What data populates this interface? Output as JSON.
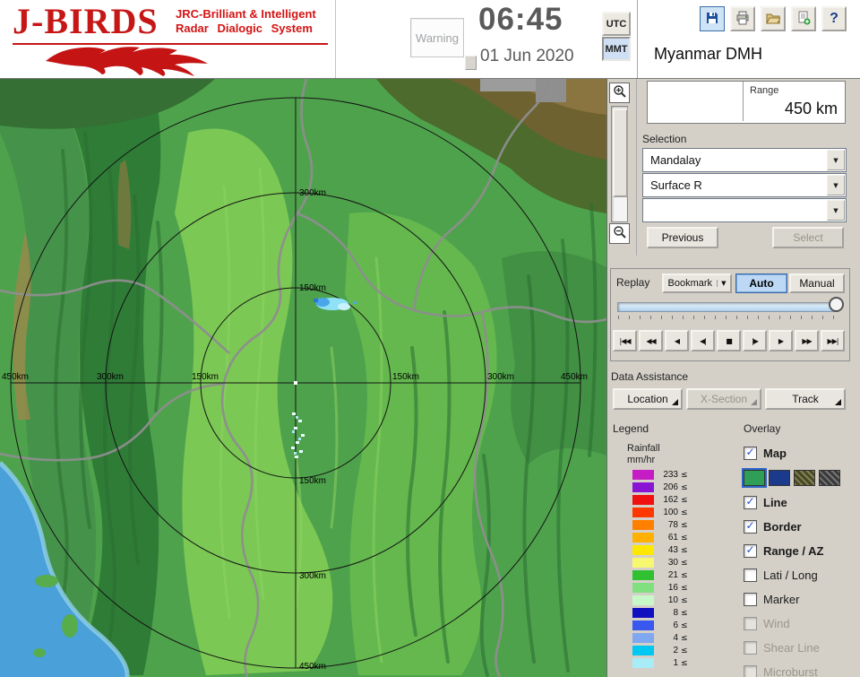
{
  "header": {
    "logo": {
      "title": "J-BIRDS",
      "subtitle1": "JRC-Brilliant & Intelligent",
      "subtitle2": "Radar Dialogic System"
    },
    "warning": "Warning",
    "time": "06:45",
    "date": "01 Jun 2020",
    "tz": {
      "utc": "UTC",
      "mmt": "MMT",
      "selected": "MMT"
    },
    "station": "Myanmar DMH",
    "help_glyph": "?"
  },
  "range": {
    "label": "Range",
    "value": "450 km"
  },
  "selection": {
    "title": "Selection",
    "dropdowns": [
      {
        "value": "Mandalay"
      },
      {
        "value": "Surface R"
      },
      {
        "value": ""
      }
    ],
    "previous": "Previous",
    "select": "Select"
  },
  "replay": {
    "title": "Replay",
    "bookmark": "Bookmark",
    "auto": "Auto",
    "manual": "Manual",
    "playback": [
      {
        "name": "jump-start",
        "glyph": "|◀◀"
      },
      {
        "name": "rewind",
        "glyph": "◀◀"
      },
      {
        "name": "step-back",
        "glyph": "◀"
      },
      {
        "name": "pause-back",
        "glyph": "◀|"
      },
      {
        "name": "stop",
        "glyph": "■"
      },
      {
        "name": "pause-forward",
        "glyph": "|▶"
      },
      {
        "name": "play",
        "glyph": "▶"
      },
      {
        "name": "fast-forward",
        "glyph": "▶▶"
      },
      {
        "name": "jump-end",
        "glyph": "▶▶|"
      }
    ]
  },
  "assist": {
    "title": "Data Assistance",
    "location": "Location",
    "xsection": "X-Section",
    "track": "Track"
  },
  "legend": {
    "title": "Legend",
    "unit1": "Rainfall",
    "unit2": "mm/hr",
    "suffix": "≤",
    "rows": [
      {
        "value": "233",
        "color": "#C61CC6"
      },
      {
        "value": "206",
        "color": "#8A14D4"
      },
      {
        "value": "162",
        "color": "#F01010"
      },
      {
        "value": "100",
        "color": "#FF3800"
      },
      {
        "value": "78",
        "color": "#FF8000"
      },
      {
        "value": "61",
        "color": "#FFB000"
      },
      {
        "value": "43",
        "color": "#FFE800"
      },
      {
        "value": "30",
        "color": "#F8F870"
      },
      {
        "value": "21",
        "color": "#30C030"
      },
      {
        "value": "16",
        "color": "#80E080"
      },
      {
        "value": "10",
        "color": "#C8F8C8"
      },
      {
        "value": "8",
        "color": "#1010C0"
      },
      {
        "value": "6",
        "color": "#3858F0"
      },
      {
        "value": "4",
        "color": "#80A8F0"
      },
      {
        "value": "2",
        "color": "#00C8F0"
      },
      {
        "value": "1",
        "color": "#A8ECF8"
      }
    ]
  },
  "overlay": {
    "title": "Overlay",
    "check_glyph": "✓",
    "items": [
      {
        "label": "Map",
        "checked": true,
        "enabled": true
      },
      {
        "label": "Line",
        "checked": true,
        "enabled": true
      },
      {
        "label": "Border",
        "checked": true,
        "enabled": true
      },
      {
        "label": "Range / AZ",
        "checked": true,
        "enabled": true
      },
      {
        "label": "Lati / Long",
        "checked": false,
        "enabled": true
      },
      {
        "label": "Marker",
        "checked": false,
        "enabled": true
      },
      {
        "label": "Wind",
        "checked": false,
        "enabled": false
      },
      {
        "label": "Shear Line",
        "checked": false,
        "enabled": false
      },
      {
        "label": "Microburst",
        "checked": false,
        "enabled": false
      }
    ],
    "map_swatches": [
      {
        "color": "#2F9E57",
        "selected": true,
        "hatch": false
      },
      {
        "color": "#1B3A8C",
        "selected": false,
        "hatch": false
      },
      {
        "color": "#4A4A1E",
        "selected": false,
        "hatch": true
      },
      {
        "color": "#3A3A3A",
        "selected": false,
        "hatch": true
      }
    ]
  },
  "map": {
    "labels": {
      "h": [
        "450km",
        "300km",
        "150km",
        "150km",
        "300km",
        "450km"
      ],
      "v": [
        "300km",
        "150km",
        "150km",
        "300km",
        "450km"
      ]
    }
  },
  "ui": {
    "dropdown_arrow": "▼"
  }
}
